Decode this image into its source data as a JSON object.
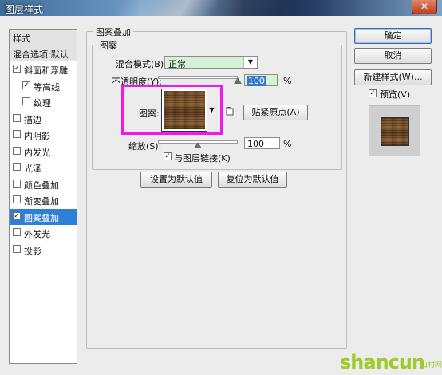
{
  "window": {
    "title": "图层样式",
    "close_glyph": "✕"
  },
  "sidebar": {
    "header": "样式",
    "blend_options": "混合选项:默认",
    "items": [
      {
        "label": "斜面和浮雕",
        "checked": true,
        "selected": false
      },
      {
        "label": "等高线",
        "checked": true,
        "selected": false,
        "indent": true
      },
      {
        "label": "纹理",
        "checked": false,
        "selected": false,
        "indent": true
      },
      {
        "label": "描边",
        "checked": false,
        "selected": false
      },
      {
        "label": "内阴影",
        "checked": false,
        "selected": false
      },
      {
        "label": "内发光",
        "checked": false,
        "selected": false
      },
      {
        "label": "光泽",
        "checked": false,
        "selected": false
      },
      {
        "label": "颜色叠加",
        "checked": false,
        "selected": false
      },
      {
        "label": "渐变叠加",
        "checked": false,
        "selected": false
      },
      {
        "label": "图案叠加",
        "checked": true,
        "selected": true
      },
      {
        "label": "外发光",
        "checked": false,
        "selected": false
      },
      {
        "label": "投影",
        "checked": false,
        "selected": false
      }
    ]
  },
  "panel": {
    "title": "图案叠加",
    "subgroup_title": "图案",
    "blend_mode_label": "混合模式(B):",
    "blend_mode_value": "正常",
    "opacity_label": "不透明度(Y):",
    "opacity_value": "100",
    "opacity_unit": "%",
    "opacity_level": 1.0,
    "pattern_label": "图案:",
    "snap_origin_button": "贴紧原点(A)",
    "scale_label": "缩放(S):",
    "scale_value": "100",
    "scale_unit": "%",
    "scale_level": 0.5,
    "link_layer_label": "与图层链接(K)",
    "link_layer_checked": true,
    "make_default_button": "设置为默认值",
    "reset_default_button": "复位为默认值"
  },
  "actions": {
    "ok": "确定",
    "cancel": "取消",
    "new_style": "新建样式(W)...",
    "preview_label": "预览(V)",
    "preview_checked": true
  },
  "watermark": {
    "text": "shancun",
    "cn": "山村网"
  },
  "colors": {
    "selection": "#2f7fd7",
    "highlight_box": "#ef18ef",
    "field_green": "#d6f2d6",
    "watermark": "#9dcc2a"
  }
}
